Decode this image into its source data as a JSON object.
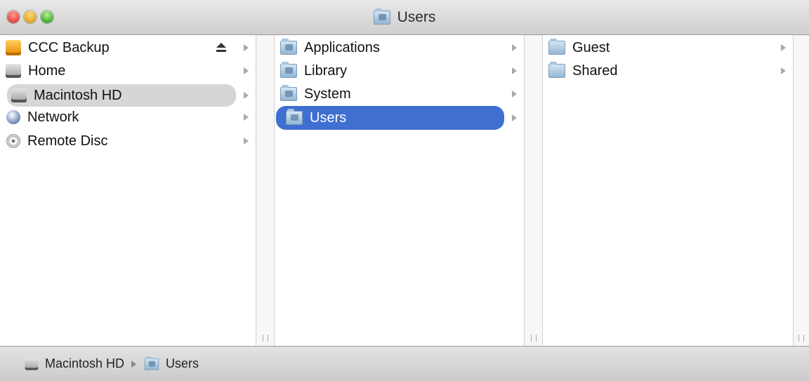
{
  "window": {
    "title": "Users",
    "title_icon": "users-folder-icon"
  },
  "sidebar": {
    "items": [
      {
        "label": "CCC Backup",
        "icon": "external-drive-icon",
        "ejectable": true
      },
      {
        "label": "Home",
        "icon": "hard-drive-icon"
      },
      {
        "label": "Macintosh HD",
        "icon": "hard-drive-icon",
        "selected": true
      },
      {
        "label": "Network",
        "icon": "network-globe-icon"
      },
      {
        "label": "Remote Disc",
        "icon": "disc-icon"
      }
    ]
  },
  "column2": {
    "items": [
      {
        "label": "Applications",
        "icon": "applications-folder-icon"
      },
      {
        "label": "Library",
        "icon": "library-folder-icon"
      },
      {
        "label": "System",
        "icon": "system-folder-icon"
      },
      {
        "label": "Users",
        "icon": "users-folder-icon",
        "selected": true
      }
    ]
  },
  "column3": {
    "items": [
      {
        "label": "Guest",
        "icon": "folder-icon"
      },
      {
        "label": "Shared",
        "icon": "folder-icon"
      }
    ]
  },
  "pathbar": {
    "segments": [
      {
        "label": "Macintosh HD",
        "icon": "hard-drive-icon"
      },
      {
        "label": "Users",
        "icon": "users-folder-icon"
      }
    ]
  },
  "colors": {
    "selection_blue": "#3f6fd1",
    "selection_grey": "#d6d6d6"
  }
}
